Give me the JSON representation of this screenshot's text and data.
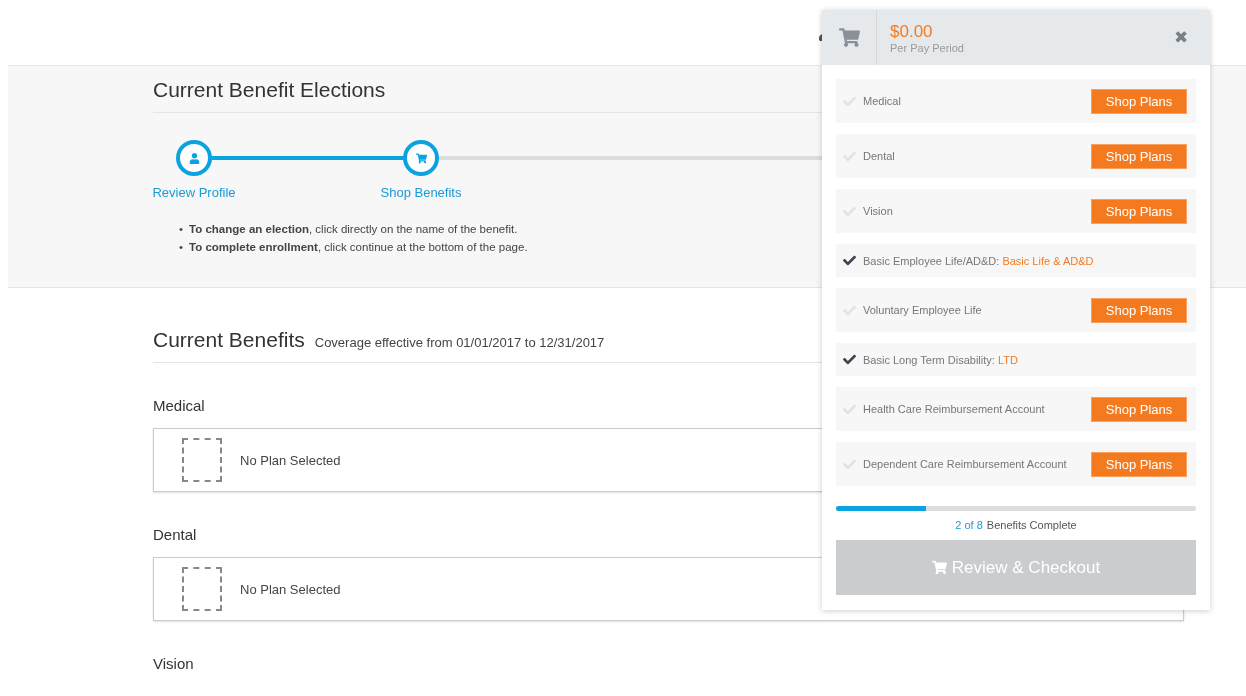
{
  "header": {
    "title": "Current Benefit Elections"
  },
  "steps": [
    {
      "label": "Review Profile",
      "kind": "profile"
    },
    {
      "label": "Shop Benefits",
      "kind": "cart"
    }
  ],
  "stepper": {
    "level": 0.23
  },
  "instructions": [
    {
      "bullet": "•",
      "text": "**To change an election**, click directly on the name of the benefit."
    },
    {
      "bullet": "•",
      "text": "**To complete enrollment**, click continue at the bottom of the page."
    }
  ],
  "current_benefits": {
    "title": "Current Benefits",
    "subtitle": "Coverage effective from 01/01/2017 to 12/31/2017"
  },
  "sections": [
    {
      "title": "Medical",
      "plan": "No Plan Selected"
    },
    {
      "title": "Dental",
      "plan": "No Plan Selected"
    },
    {
      "title": "Vision"
    }
  ],
  "cart": {
    "amount": "$0.00",
    "period": "Per Pay Period",
    "close": "✖",
    "items": [
      {
        "name": "Medical",
        "checked": false,
        "action": "Shop Plans"
      },
      {
        "name": "Dental",
        "checked": false,
        "action": "Shop Plans"
      },
      {
        "name": "Vision",
        "checked": false,
        "action": "Shop Plans"
      },
      {
        "name": "Basic Employee Life/AD&D:",
        "checked": true,
        "plan": "Basic Life & AD&D"
      },
      {
        "name": "Voluntary Employee Life",
        "checked": false,
        "action": "Shop Plans"
      },
      {
        "name": "Basic Long Term Disability:",
        "checked": true,
        "plan": "LTD"
      },
      {
        "name": "Health Care Reimbursement Account",
        "checked": false,
        "action": "Shop Plans"
      },
      {
        "name": "Dependent Care Reimbursement Account",
        "checked": false,
        "action": "Shop Plans"
      }
    ],
    "progress": {
      "level": 0.25,
      "count": "2 of 8",
      "label": "Benefits Complete"
    },
    "checkout": {
      "label": "Review & Checkout",
      "disabled": true
    }
  }
}
